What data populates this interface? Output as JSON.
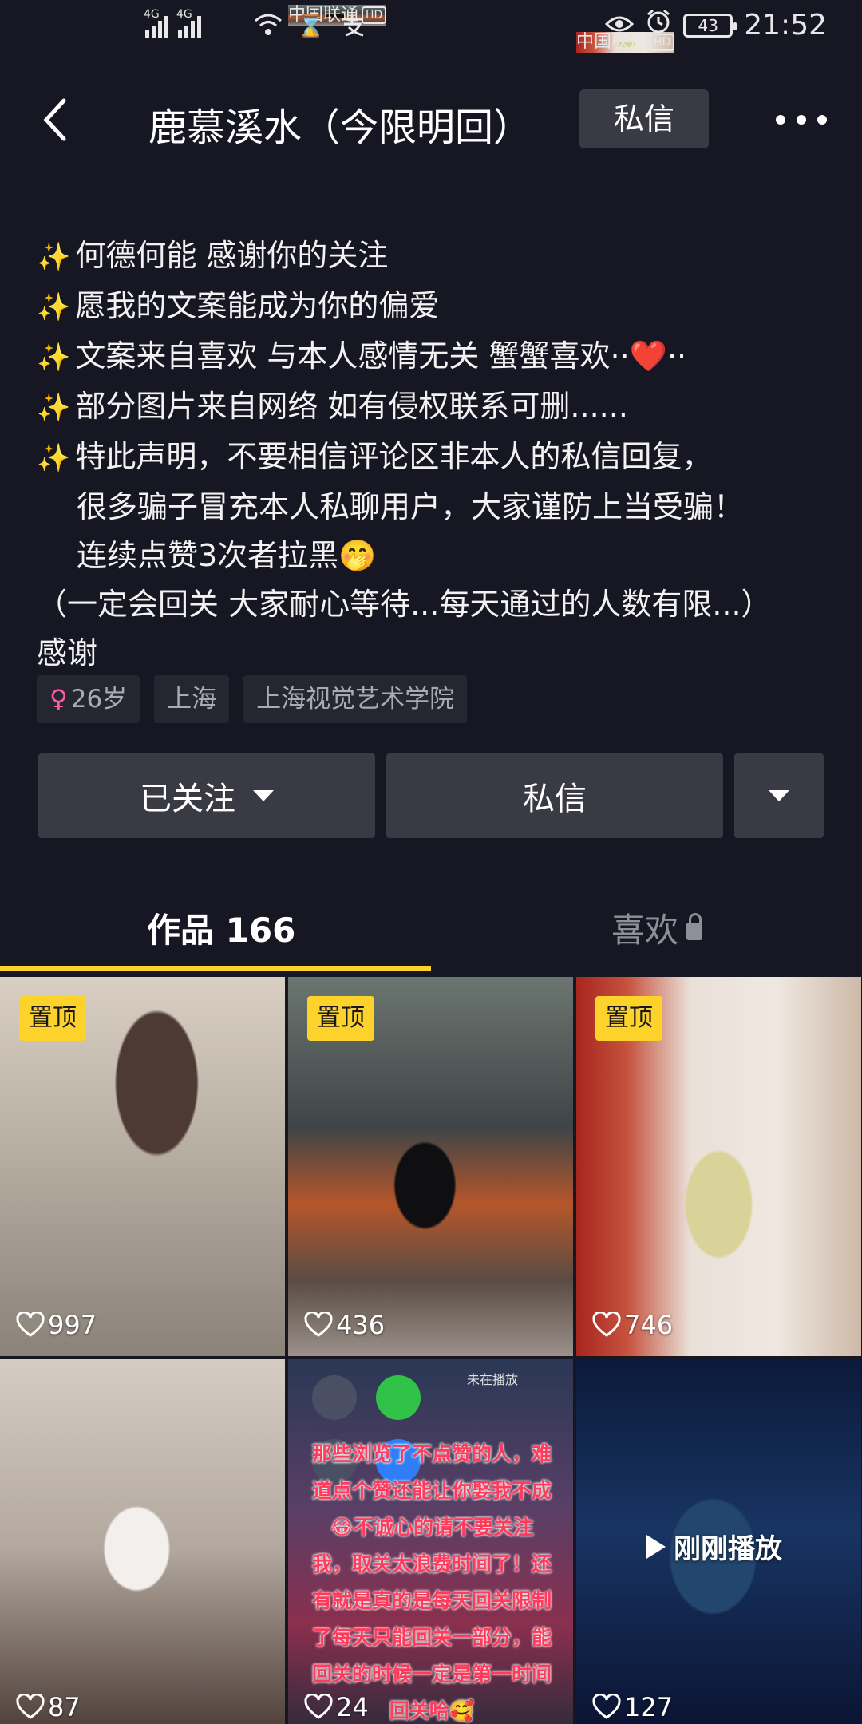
{
  "status_bar": {
    "carrier1": "中国联通",
    "carrier2": "中国联通",
    "hd": "HD",
    "net": "4G",
    "battery": "43",
    "time": "21:52"
  },
  "header": {
    "title": "鹿慕溪水（今限明回）",
    "message_label": "私信"
  },
  "bio": {
    "lines": [
      "何德何能 感谢你的关注",
      "愿我的文案能成为你的偏爱",
      "文案来自喜欢 与本人感情无关 蟹蟹喜欢··❤️··",
      "部分图片来自网络 如有侵权联系可删......",
      "特此声明，不要相信评论区非本人的私信回复，",
      "很多骗子冒充本人私聊用户，大家谨防上当受骗！",
      "连续点赞3次者拉黑🤭",
      "（一定会回关 大家耐心等待...每天通过的人数有限...）",
      "感谢"
    ]
  },
  "tags": {
    "age": "26岁",
    "city": "上海",
    "school": "上海视觉艺术学院"
  },
  "actions": {
    "follow": "已关注",
    "message": "私信"
  },
  "tabs": {
    "works": "作品 166",
    "likes": "喜欢"
  },
  "grid": {
    "pinned_label": "置顶",
    "videos": [
      {
        "likes": "997",
        "pinned": true
      },
      {
        "likes": "436",
        "pinned": true
      },
      {
        "likes": "746",
        "pinned": true
      },
      {
        "likes": "87",
        "pinned": false
      },
      {
        "likes": "24",
        "pinned": false
      },
      {
        "likes": "127",
        "pinned": false
      }
    ],
    "overlay_text": "那些浏览了不点赞的人，难道点个赞还能让你娶我不成😂不诚心的请不要关注我，取关太浪费时间了！还有就是真的是每天回关限制了每天只能回关一部分，能回关的时候一定是第一时间回关哈🥰",
    "now_playing": "未在播放",
    "recently_played": "刚刚播放"
  },
  "colors": {
    "background": "#161722",
    "accent": "#fdd22b",
    "button": "#393a44",
    "tag": "#25262f"
  }
}
